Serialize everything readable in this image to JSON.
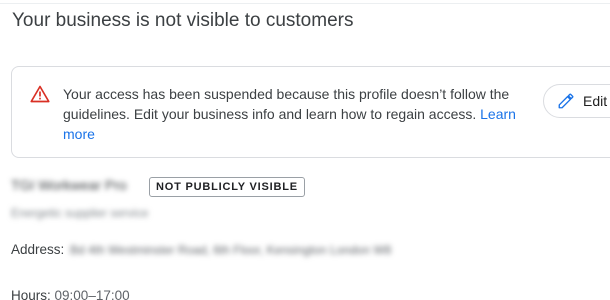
{
  "heading": "Your business is not visible to customers",
  "alert": {
    "icon": "warning-triangle-icon",
    "icon_color": "#d93025",
    "message": "Your access has been suspended because this profile doesn’t follow the guidelines. Edit your business info and learn how to regain access.",
    "learn_more_label": "Learn more",
    "link_color": "#1a73e8",
    "edit_label": "Edit",
    "edit_icon": "pencil-icon"
  },
  "business": {
    "name": "TGI Workwear Pro",
    "visibility_badge": "NOT PUBLICLY VISIBLE",
    "category": "Energetic supplier service",
    "address_label": "Address:",
    "address_value": "Bd 4th Westminster Road, 6th Floor, Kensington London W8",
    "hours_label": "Hours:",
    "hours_value": "09:00–17:00"
  }
}
